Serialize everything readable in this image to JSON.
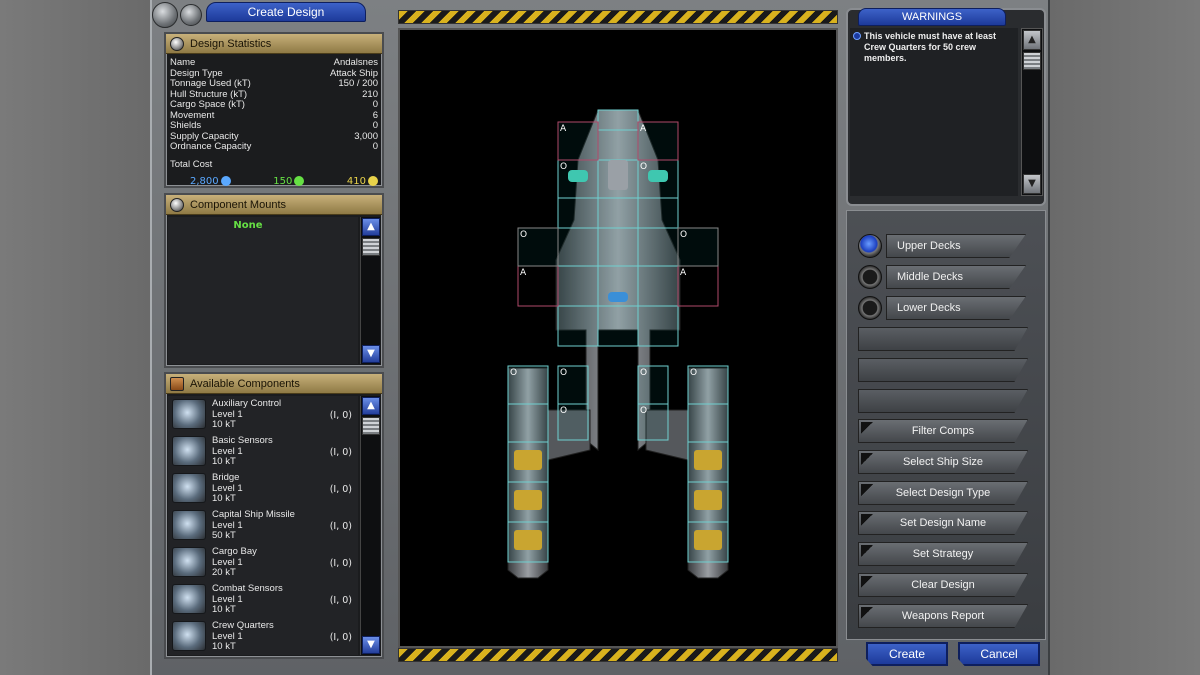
{
  "window": {
    "title": "Create Design"
  },
  "design_statistics": {
    "header": "Design Statistics",
    "rows": [
      {
        "label": "Name",
        "value": "Andalsnes"
      },
      {
        "label": "Design Type",
        "value": "Attack Ship"
      },
      {
        "label": "Tonnage Used (kT)",
        "value": "150 / 200"
      },
      {
        "label": "Hull Structure (kT)",
        "value": "210"
      },
      {
        "label": "Cargo Space (kT)",
        "value": "0"
      },
      {
        "label": "Movement",
        "value": "6"
      },
      {
        "label": "Shields",
        "value": "0"
      },
      {
        "label": "Supply Capacity",
        "value": "3,000"
      },
      {
        "label": "Ordnance Capacity",
        "value": "0"
      }
    ],
    "total_cost_label": "Total Cost",
    "cost": {
      "minerals": "2,800",
      "organics": "150",
      "radioactives": "410"
    },
    "colors": {
      "minerals": "#5aa8ff",
      "organics": "#66e044",
      "radioactives": "#e8d24a"
    }
  },
  "component_mounts": {
    "header": "Component Mounts",
    "value": "None"
  },
  "available_components": {
    "header": "Available Components",
    "items": [
      {
        "name": "Auxiliary Control",
        "level": "Level 1",
        "size": "10 kT",
        "coords": "(I, 0)"
      },
      {
        "name": "Basic Sensors",
        "level": "Level 1",
        "size": "10 kT",
        "coords": "(I, 0)"
      },
      {
        "name": "Bridge",
        "level": "Level 1",
        "size": "10 kT",
        "coords": "(I, 0)"
      },
      {
        "name": "Capital Ship Missile",
        "level": "Level 1",
        "size": "50 kT",
        "coords": "(I, 0)"
      },
      {
        "name": "Cargo Bay",
        "level": "Level 1",
        "size": "20 kT",
        "coords": "(I, 0)"
      },
      {
        "name": "Combat Sensors",
        "level": "Level 1",
        "size": "10 kT",
        "coords": "(I, 0)"
      },
      {
        "name": "Crew Quarters",
        "level": "Level 1",
        "size": "10 kT",
        "coords": "(I, 0)"
      }
    ]
  },
  "warnings": {
    "title": "WARNINGS",
    "message": "This vehicle must have at least Crew Quarters for 50 crew members."
  },
  "decks": [
    {
      "label": "Upper Decks",
      "selected": true
    },
    {
      "label": "Middle Decks",
      "selected": false
    },
    {
      "label": "Lower Decks",
      "selected": false
    }
  ],
  "actions": [
    "Filter Comps",
    "Select Ship Size",
    "Select Design Type",
    "Set Design Name",
    "Set Strategy",
    "Clear Design",
    "Weapons Report"
  ],
  "footer": {
    "create": "Create",
    "cancel": "Cancel"
  },
  "ship_grid": {
    "cell_labels": [
      "A",
      "O"
    ]
  }
}
